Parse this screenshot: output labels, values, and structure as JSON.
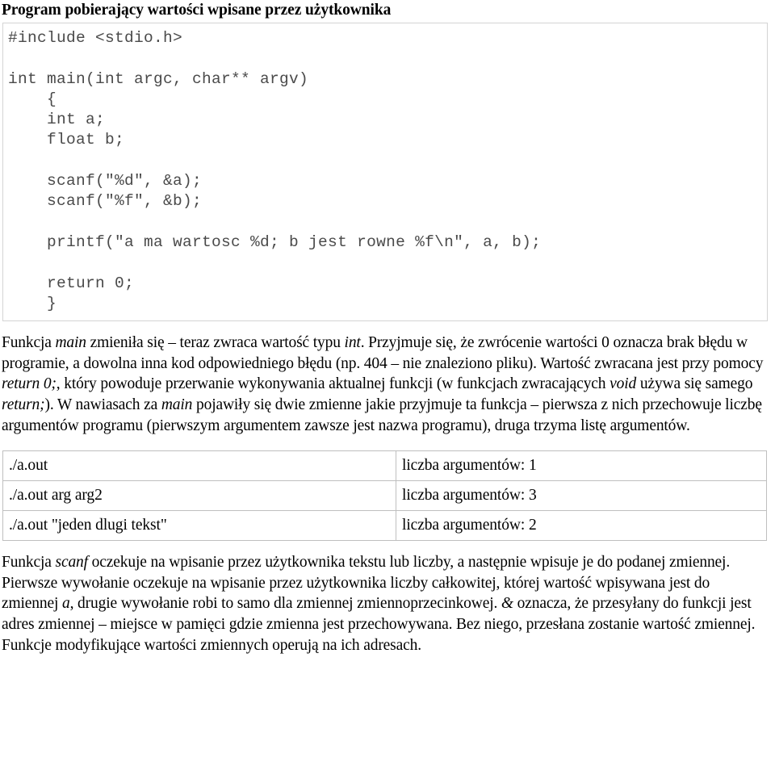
{
  "document": {
    "title": "Program pobierający wartości wpisane przez użytkownika",
    "code_block": {
      "language": "c",
      "text": "#include <stdio.h>\n\nint main(int argc, char** argv)\n    {\n    int a;\n    float b;\n\n    scanf(\"%d\", &a);\n    scanf(\"%f\", &b);\n\n    printf(\"a ma wartosc %d; b jest rowne %f\\n\", a, b);\n\n    return 0;\n    }"
    },
    "paragraph_1": {
      "seg_1": "Funkcja ",
      "em_1": "main",
      "seg_2": " zmieniła się – teraz zwraca wartość typu ",
      "em_2": "int",
      "seg_3": ". Przyjmuje się, że zwrócenie wartości 0 oznacza brak błędu w programie, a dowolna inna kod odpowiedniego błędu (np. 404 – nie znaleziono pliku). Wartość zwracana jest przy pomocy ",
      "em_3": "return 0;",
      "seg_4": ", który powoduje przerwanie wykonywania aktualnej funkcji (w funkcjach zwracających ",
      "em_4": "void",
      "seg_5": " używa się samego ",
      "em_5": "return;",
      "seg_6": "). W nawiasach za ",
      "em_6": "main",
      "seg_7": " pojawiły się dwie zmienne jakie przyjmuje ta funkcja – pierwsza z nich przechowuje liczbę argumentów programu (pierwszym argumentem zawsze jest nazwa programu), druga trzyma listę argumentów."
    },
    "table": {
      "rows": [
        {
          "command": "./a.out",
          "result": "liczba argumentów: 1"
        },
        {
          "command": "./a.out arg arg2",
          "result": "liczba argumentów: 3"
        },
        {
          "command": "./a.out \"jeden dlugi tekst\"",
          "result": "liczba argumentów: 2"
        }
      ]
    },
    "paragraph_2": {
      "seg_1": "Funkcja ",
      "em_1": "scanf",
      "seg_2": " oczekuje na wpisanie przez użytkownika tekstu lub liczby, a następnie wpisuje je do podanej zmiennej. Pierwsze wywołanie oczekuje na wpisanie przez użytkownika liczby całkowitej, której wartość wpisywana jest do zmiennej ",
      "em_2": "a",
      "seg_3": ", drugie wywołanie robi to samo dla zmiennej zmiennoprzecinkowej. ",
      "em_3": "&",
      "seg_4": " oznacza, że przesyłany do funkcji jest adres zmiennej – miejsce w pamięci gdzie zmienna jest przechowywana. Bez niego, przesłana zostanie wartość zmiennej. Funkcje modyfikujące wartości zmiennych operują na ich adresach."
    }
  },
  "colors": {
    "code_text": "#4a4a4a",
    "code_border": "#d4d4d4",
    "table_border": "#bfbfbf",
    "body_text": "#000000",
    "background": "#ffffff"
  }
}
